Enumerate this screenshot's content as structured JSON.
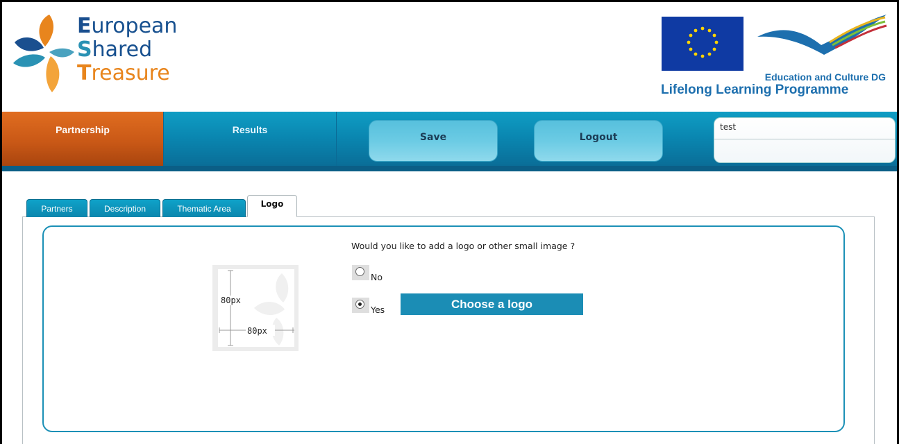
{
  "header": {
    "brand": {
      "line1_initial": "E",
      "line1_rest": "uropean",
      "line2_initial": "S",
      "line2_rest": "hared",
      "line3_initial": "T",
      "line3_rest": "reasure"
    },
    "eu_dg": "Education and Culture DG",
    "eu_programme": "Lifelong Learning Programme"
  },
  "nav": {
    "partnership": "Partnership",
    "results": "Results",
    "save": "Save",
    "logout": "Logout",
    "user": "test"
  },
  "tabs": [
    {
      "label": "Partners",
      "active": false
    },
    {
      "label": "Description",
      "active": false
    },
    {
      "label": "Thematic Area",
      "active": false
    },
    {
      "label": "Logo",
      "active": true
    }
  ],
  "logo_form": {
    "question": "Would you like to add a logo or other small image ?",
    "option_no": "No",
    "option_yes": "Yes",
    "selected": "Yes",
    "choose_button": "Choose a logo",
    "preview_height_label": "80px",
    "preview_width_label": "80px"
  },
  "colors": {
    "accent_orange": "#e06d20",
    "accent_blue": "#0a86b0",
    "button_blue": "#1b8db5",
    "brand_dark_blue": "#1a4f8f",
    "brand_light_blue": "#2a92b4",
    "brand_orange": "#e8851d"
  }
}
